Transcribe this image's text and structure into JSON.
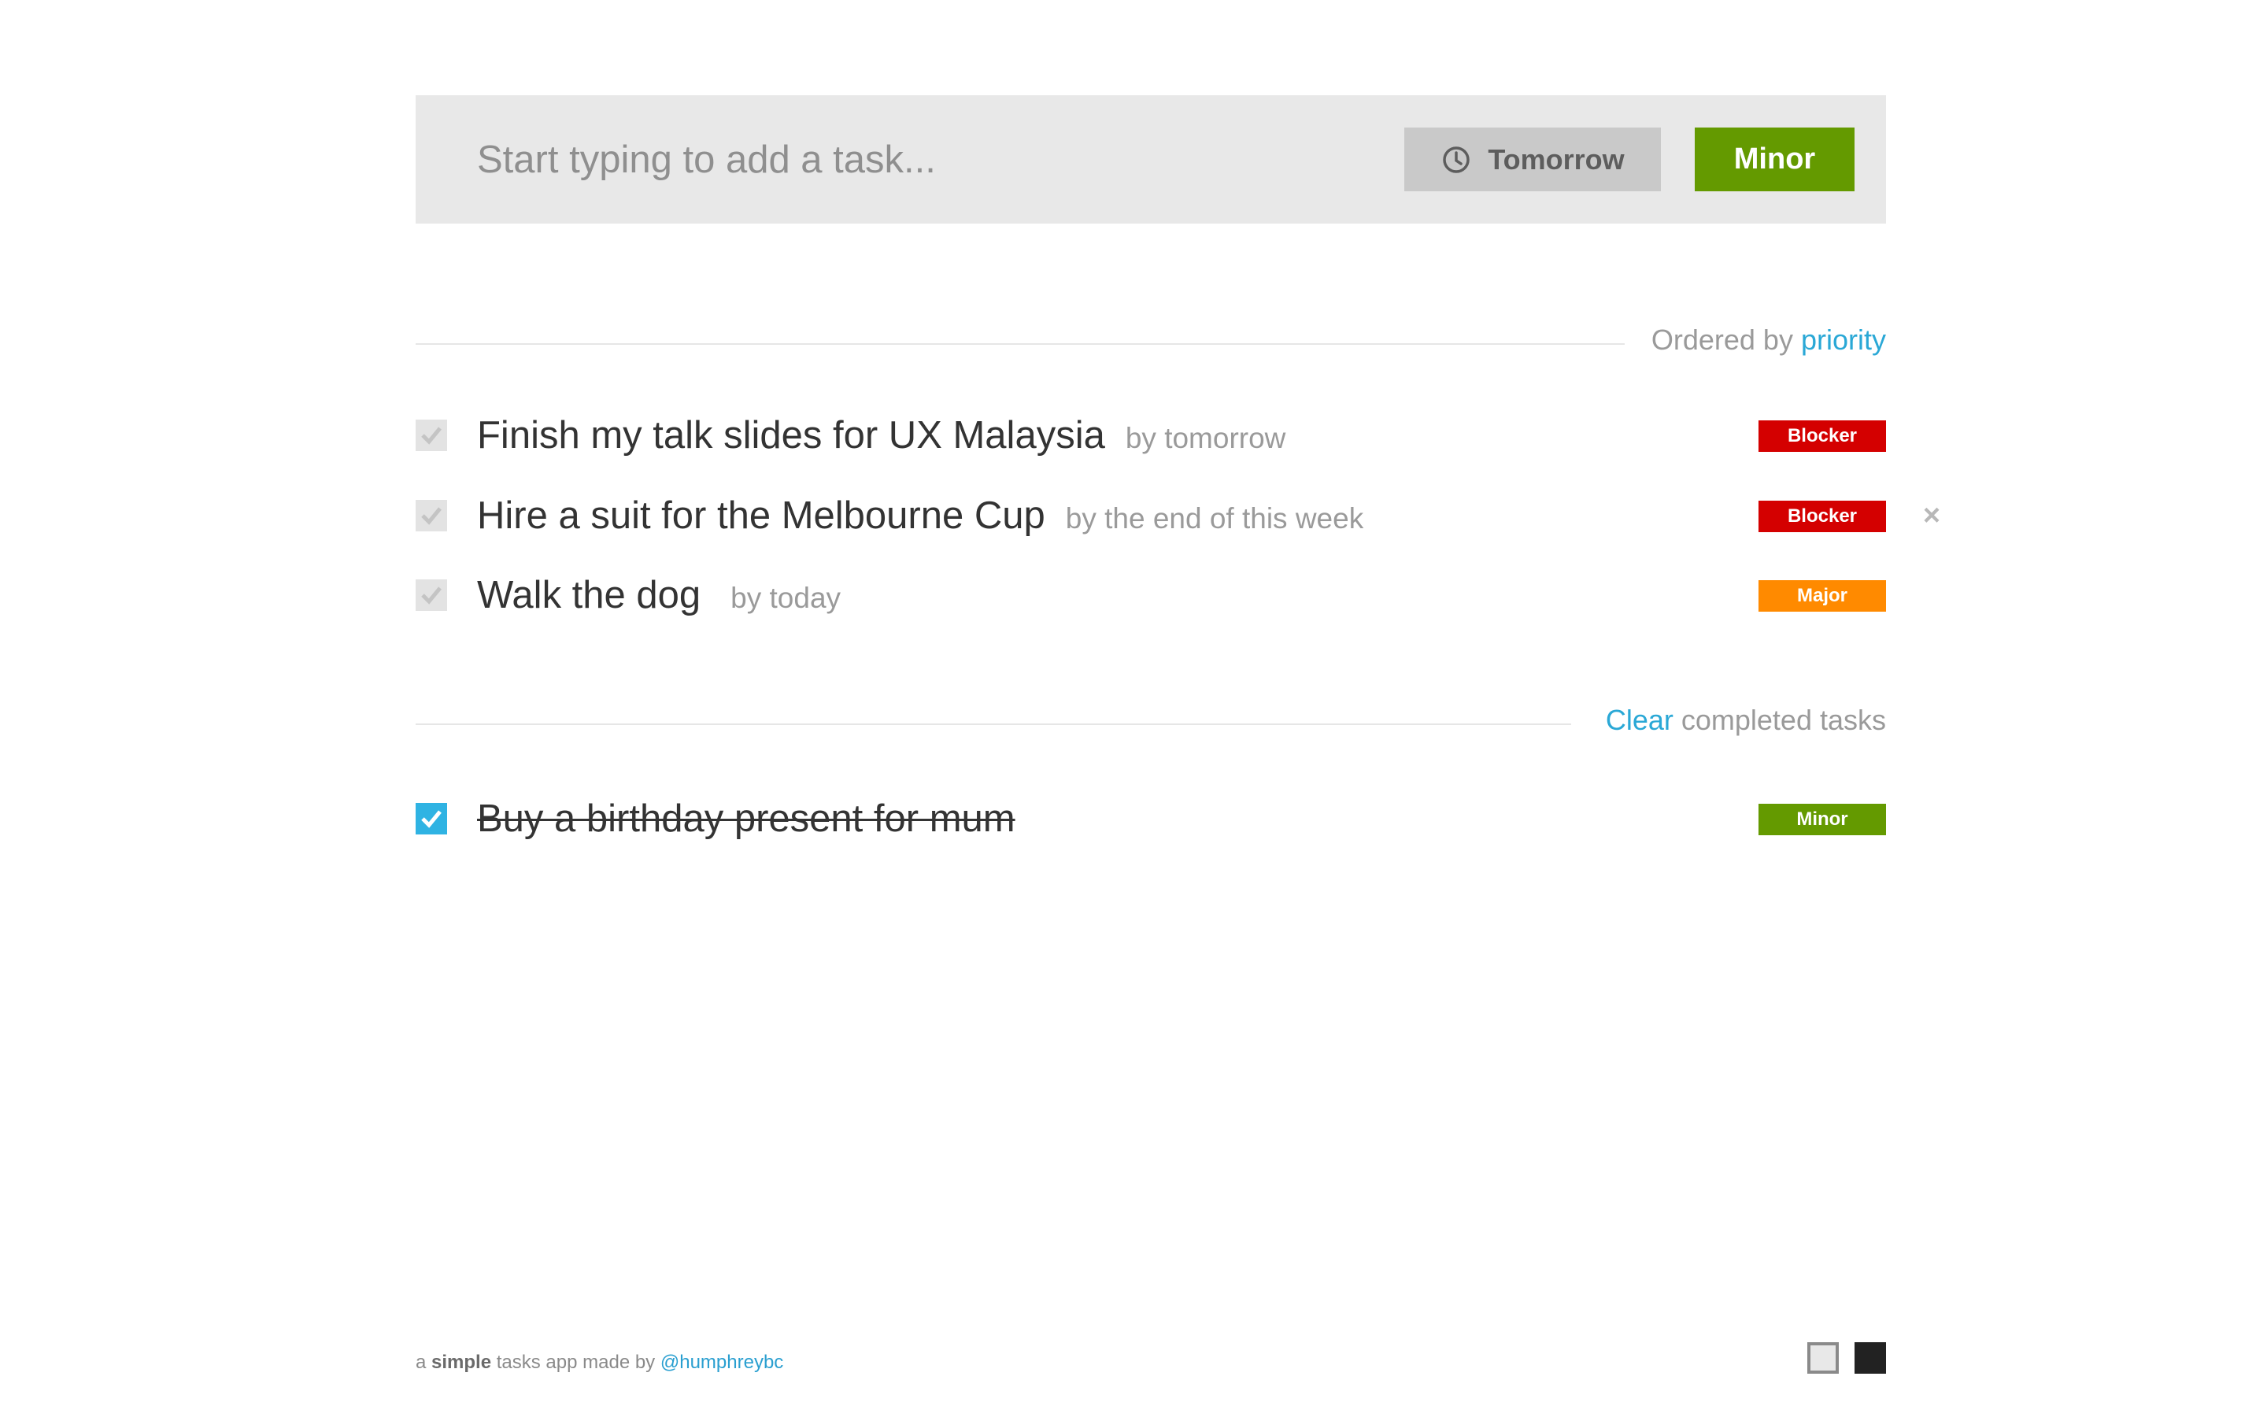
{
  "add_task": {
    "placeholder": "Start typing to add a task...",
    "due_label": "Tomorrow",
    "due_icon": "clock-icon",
    "priority_label": "Minor",
    "priority_color": "#649a00"
  },
  "active_section": {
    "order_prefix": "Ordered by",
    "order_link": "priority"
  },
  "tasks": [
    {
      "title": "Finish my talk slides for UX Malaysia",
      "due": "by tomorrow",
      "priority": "Blocker",
      "color": "#d40000"
    },
    {
      "title": "Hire a suit for the Melbourne Cup",
      "due": "by the end of this week",
      "priority": "Blocker",
      "color": "#d40000"
    },
    {
      "title": "Walk the dog",
      "due": "by today",
      "priority": "Major",
      "color": "#ff8a00"
    }
  ],
  "delete_symbol": "×",
  "completed_section": {
    "clear_link": "Clear",
    "clear_suffix": "completed tasks"
  },
  "completed_tasks": [
    {
      "title": "Buy a birthday present for mum",
      "priority": "Minor",
      "color": "#649a00"
    }
  ],
  "footer": {
    "prefix": "a",
    "bold": "simple",
    "middle": "tasks app made by",
    "handle": "@humphreybc"
  },
  "colors": {
    "accent": "#2aa8d6",
    "checked": "#2fb3e3"
  }
}
